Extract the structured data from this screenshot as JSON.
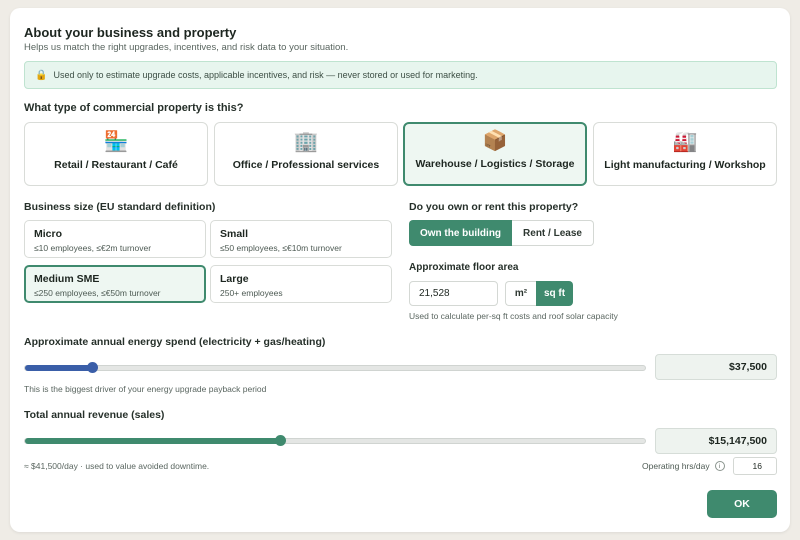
{
  "header": {
    "title": "About your business and property",
    "subtitle": "Helps us match the right upgrades, incentives, and risk data to your situation."
  },
  "privacy_banner": {
    "icon": "lock-icon",
    "text": "Used only to estimate upgrade costs, applicable incentives, and risk — never stored or used for marketing."
  },
  "property_type": {
    "question": "What type of commercial property is this?",
    "options": [
      {
        "label": "Retail / Restaurant / Café",
        "icon": "store-icon",
        "glyph": "🏪",
        "selected": false
      },
      {
        "label": "Office / Professional services",
        "icon": "office-building-icon",
        "glyph": "🏢",
        "selected": false
      },
      {
        "label": "Warehouse / Logistics / Storage",
        "icon": "package-icon",
        "glyph": "📦",
        "selected": true
      },
      {
        "label": "Light manufacturing / Workshop",
        "icon": "factory-icon",
        "glyph": "🏭",
        "selected": false
      }
    ]
  },
  "business_size": {
    "question": "Business size (EU standard definition)",
    "options": [
      {
        "name": "Micro",
        "desc": "≤10 employees, ≤€2m turnover",
        "selected": false
      },
      {
        "name": "Small",
        "desc": "≤50 employees, ≤€10m turnover",
        "selected": false
      },
      {
        "name": "Medium SME",
        "desc": "≤250 employees, ≤€50m turnover",
        "selected": true
      },
      {
        "name": "Large",
        "desc": "250+ employees",
        "selected": false
      }
    ]
  },
  "ownership": {
    "question": "Do you own or rent this property?",
    "own_label": "Own the building",
    "rent_label": "Rent / Lease",
    "selected": "own"
  },
  "floor_area": {
    "label": "Approximate floor area",
    "value": "21,528",
    "unit_m2": "m²",
    "unit_sqft": "sq ft",
    "selected_unit": "sq ft",
    "hint": "Used to calculate per-sq ft costs and roof solar capacity"
  },
  "energy_spend": {
    "label": "Approximate annual energy spend (electricity + gas/heating)",
    "value": "$37,500",
    "slider_fraction": 0.108,
    "hint": "This is the biggest driver of your energy upgrade payback period"
  },
  "revenue": {
    "label": "Total annual revenue (sales)",
    "value": "$15,147,500",
    "slider_fraction": 0.411,
    "hint": "≈ $41,500/day · used to value avoided downtime."
  },
  "operating_hours": {
    "label": "Operating hrs/day",
    "info_icon": "info-icon",
    "value": "16"
  },
  "actions": {
    "ok_label": "OK"
  },
  "colors": {
    "accent": "#3f8a6e",
    "energy_slider": "#3a5ea8",
    "revenue_slider": "#3f8a6e"
  }
}
